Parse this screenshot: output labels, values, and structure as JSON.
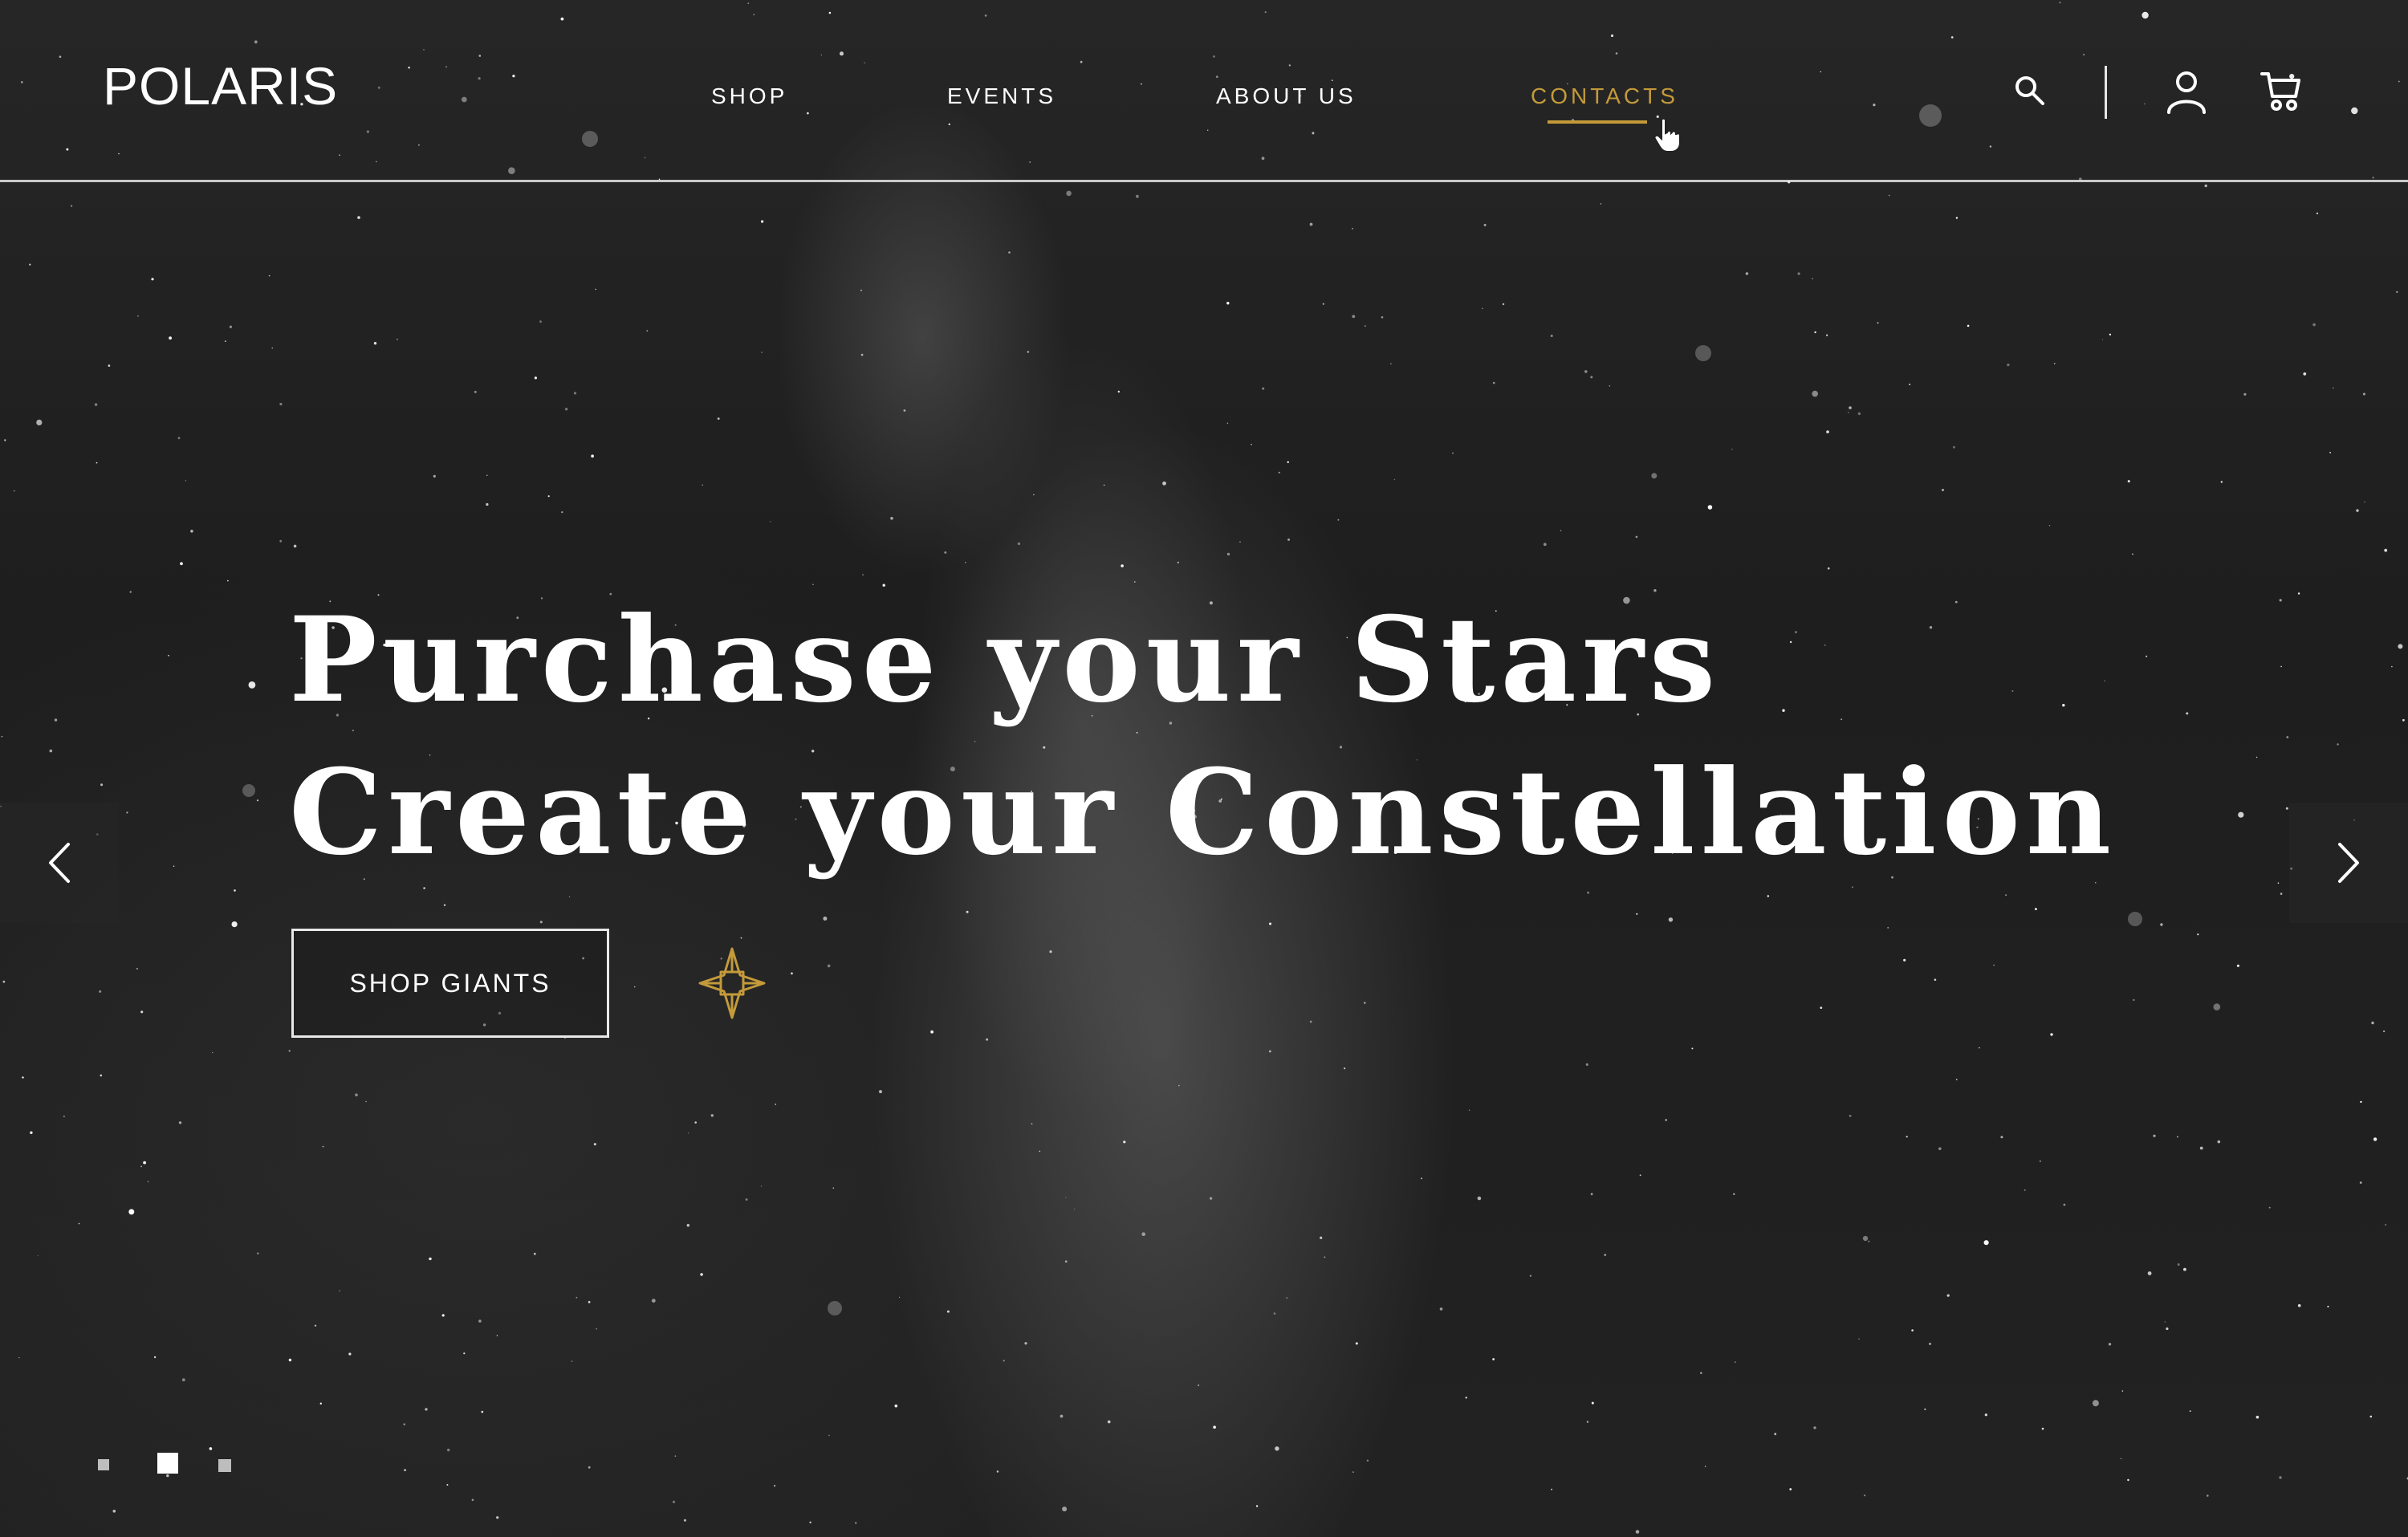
{
  "brand": {
    "logo_text": "POLARIS"
  },
  "nav": {
    "items": [
      {
        "label": "SHOP",
        "active": false
      },
      {
        "label": "EVENTS",
        "active": false
      },
      {
        "label": "ABOUT US",
        "active": false
      },
      {
        "label": "CONTACTS",
        "active": true
      }
    ]
  },
  "header_icons": [
    "search-icon",
    "user-icon",
    "cart-icon"
  ],
  "hero": {
    "headline_line1": "Purchase your Stars",
    "headline_line2": "Create your Constellation",
    "cta_label": "SHOP GIANTS",
    "decoration_icon": "compass-star-icon"
  },
  "carousel": {
    "prev_icon": "chevron-left-icon",
    "next_icon": "chevron-right-icon",
    "slide_count": 3,
    "active_slide": 2
  },
  "colors": {
    "accent": "#c49a3a",
    "text": "#ffffff",
    "background": "#1e1e1e"
  }
}
